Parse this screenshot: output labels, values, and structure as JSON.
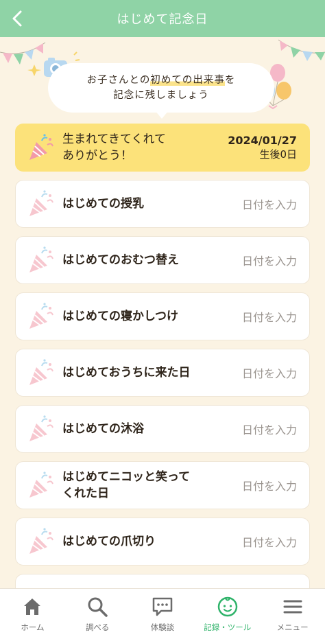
{
  "header": {
    "title": "はじめて記念日"
  },
  "banner": {
    "line1_pre": "お子さんとの",
    "line1_highlight": "初めての出来事",
    "line1_post": "を",
    "line2": "記念に残しましょう"
  },
  "featured": {
    "title_line1": "生まれてきてくれて",
    "title_line2": "ありがとう！",
    "date": "2024/01/27",
    "age": "生後0日"
  },
  "milestones": [
    {
      "title_line1": "はじめての授乳",
      "title_line2": "",
      "action": "日付を入力"
    },
    {
      "title_line1": "はじめてのおむつ替え",
      "title_line2": "",
      "action": "日付を入力"
    },
    {
      "title_line1": "はじめての寝かしつけ",
      "title_line2": "",
      "action": "日付を入力"
    },
    {
      "title_line1": "はじめておうちに来た日",
      "title_line2": "",
      "action": "日付を入力"
    },
    {
      "title_line1": "はじめての沐浴",
      "title_line2": "",
      "action": "日付を入力"
    },
    {
      "title_line1": "はじめてニコッと笑って",
      "title_line2": "くれた日",
      "action": "日付を入力"
    },
    {
      "title_line1": "はじめての爪切り",
      "title_line2": "",
      "action": "日付を入力"
    }
  ],
  "tabs": [
    {
      "label": "ホーム",
      "icon": "home-icon"
    },
    {
      "label": "調べる",
      "icon": "search-icon"
    },
    {
      "label": "体験談",
      "icon": "chat-icon"
    },
    {
      "label": "記録・ツール",
      "icon": "baby-face-icon",
      "active": true
    },
    {
      "label": "メニュー",
      "icon": "menu-icon"
    }
  ],
  "colors": {
    "header": "#8fd3a6",
    "background": "#fbf3e3",
    "featured": "#fce27a",
    "active_tab": "#2fb36a"
  }
}
